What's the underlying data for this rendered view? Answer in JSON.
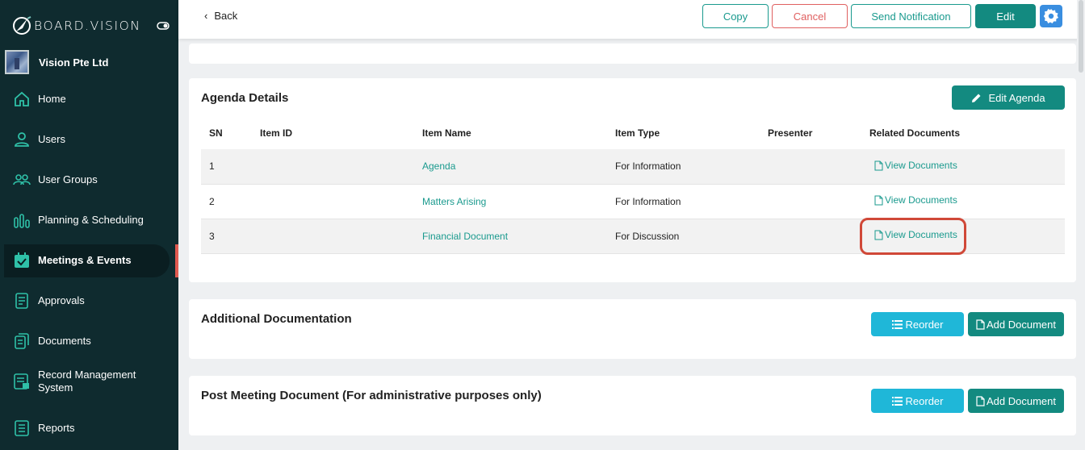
{
  "sidebar": {
    "logo_text": "BOARD.VISION",
    "org_name": "Vision Pte Ltd",
    "items": [
      {
        "label": "Home",
        "icon": "home-icon"
      },
      {
        "label": "Users",
        "icon": "user-icon"
      },
      {
        "label": "User Groups",
        "icon": "users-icon"
      },
      {
        "label": "Planning & Scheduling",
        "icon": "bar-chart-icon"
      },
      {
        "label": "Meetings & Events",
        "icon": "calendar-check-icon",
        "active": true
      },
      {
        "label": "Approvals",
        "icon": "document-icon"
      },
      {
        "label": "Documents",
        "icon": "documents-icon"
      },
      {
        "label": "Record Management",
        "label2": "System",
        "icon": "record-icon"
      },
      {
        "label": "Reports",
        "icon": "report-icon"
      }
    ]
  },
  "toolbar": {
    "back": "Back",
    "copy": "Copy",
    "cancel": "Cancel",
    "send_notification": "Send Notification",
    "edit": "Edit"
  },
  "agenda": {
    "title": "Agenda Details",
    "edit_button": "Edit Agenda",
    "headers": [
      "SN",
      "Item ID",
      "Item Name",
      "Item Type",
      "Presenter",
      "Related Documents"
    ],
    "rows": [
      {
        "sn": "1",
        "item_id": "",
        "item_name": "Agenda",
        "item_type": "For Information",
        "presenter": "",
        "docs": "View Documents"
      },
      {
        "sn": "2",
        "item_id": "",
        "item_name": "Matters Arising",
        "item_type": "For Information",
        "presenter": "",
        "docs": "View Documents"
      },
      {
        "sn": "3",
        "item_id": "",
        "item_name": "Financial Document",
        "item_type": "For Discussion",
        "presenter": "",
        "docs": "View Documents"
      }
    ]
  },
  "additional": {
    "title": "Additional Documentation",
    "reorder": "Reorder",
    "add_document": "Add Document"
  },
  "post_meeting": {
    "title": "Post Meeting Document (For administrative purposes only)",
    "reorder": "Reorder",
    "add_document": "Add Document"
  },
  "colors": {
    "sidebar_bg": "#0f2b2f",
    "accent": "#138a80",
    "cyan": "#1fb7d8",
    "highlight": "#d04838"
  }
}
